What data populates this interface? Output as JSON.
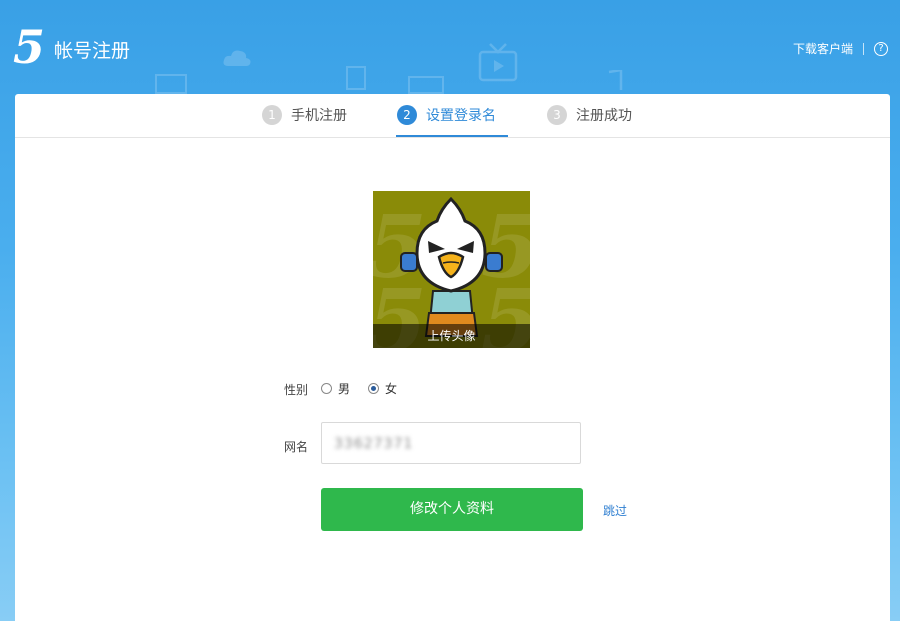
{
  "header": {
    "logo_text": "5",
    "title": "帐号注册",
    "download_label": "下载客户端",
    "help_icon": "question-circle-icon"
  },
  "steps": [
    {
      "number": "1",
      "label": "手机注册",
      "state": "done"
    },
    {
      "number": "2",
      "label": "设置登录名",
      "state": "active"
    },
    {
      "number": "3",
      "label": "注册成功",
      "state": "pending"
    }
  ],
  "avatar": {
    "upload_label": "上传头像",
    "background_color": "#8a8b08"
  },
  "form": {
    "gender_label": "性别",
    "gender_options": [
      "男",
      "女"
    ],
    "gender_selected": "女",
    "nickname_label": "网名",
    "nickname_value": "33627371",
    "submit_label": "修改个人资料",
    "skip_label": "跳过"
  },
  "colors": {
    "accent": "#2f8ad8",
    "submit": "#2fb84c",
    "header_bg": "#39a0e6"
  }
}
